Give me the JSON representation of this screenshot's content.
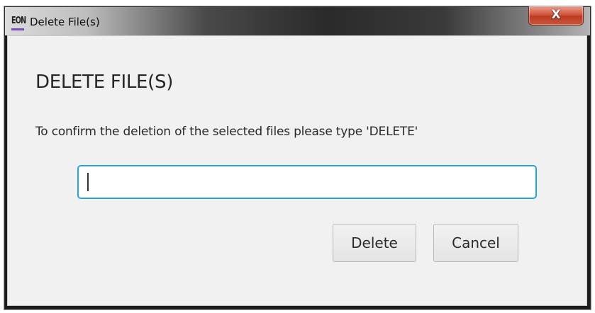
{
  "window": {
    "app_logo": "EON",
    "title": "Delete File(s)",
    "close_glyph": "X"
  },
  "dialog": {
    "heading": "DELETE FILE(S)",
    "instruction": "To confirm the deletion of the selected files please type 'DELETE'",
    "confirm_input": {
      "value": "",
      "placeholder": ""
    },
    "buttons": {
      "delete_label": "Delete",
      "cancel_label": "Cancel"
    }
  },
  "icons": {
    "app_logo": "eon-logo-icon",
    "close": "close-icon"
  },
  "colors": {
    "input_focus_border": "#2aa3dc",
    "close_button": "#c9452c",
    "logo_accent": "#7b4bb8",
    "dialog_background": "#f1f1f1"
  }
}
